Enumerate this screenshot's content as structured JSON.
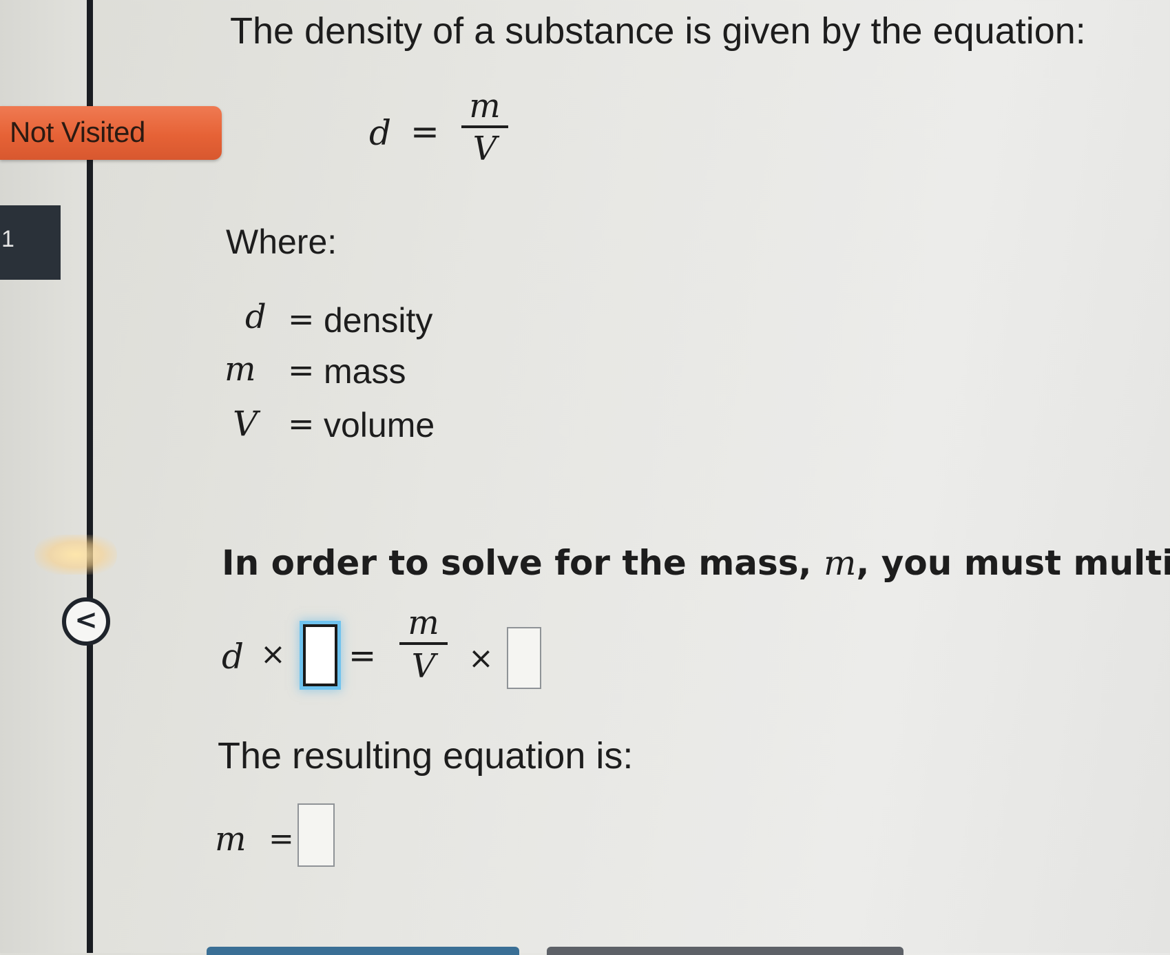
{
  "sidebar": {
    "status_badge": "Not Visited",
    "question_tab_label": "1",
    "back_button_glyph": "<"
  },
  "question": {
    "intro": "The density of a substance is given by the equation:",
    "formula": {
      "lhs": "d",
      "equals": "=",
      "numerator": "m",
      "denominator": "V"
    },
    "where_label": "Where:",
    "definitions": [
      {
        "symbol": "d",
        "equals": "=",
        "meaning": "density"
      },
      {
        "symbol": "m",
        "equals": "=",
        "meaning": "mass"
      },
      {
        "symbol": "V",
        "equals": "=",
        "meaning": "volume"
      }
    ],
    "instruction_prefix": "In order to solve for the mass, ",
    "instruction_variable": "m",
    "instruction_suffix": ", you must multiply",
    "work_equation": {
      "lhs_var": "d",
      "times": "×",
      "equals": "=",
      "numerator": "m",
      "denominator": "V",
      "times_right": "×",
      "left_box_value": "",
      "right_box_value": ""
    },
    "result_label": "The resulting equation is:",
    "result_equation": {
      "lhs": "m",
      "equals": "=",
      "box_value": ""
    }
  },
  "colors": {
    "badge": "#e66236",
    "divider": "#1a1d22",
    "focus_ring": "#6fc3ef",
    "bottom_primary": "#3a6f95",
    "bottom_secondary": "#5d6167"
  }
}
